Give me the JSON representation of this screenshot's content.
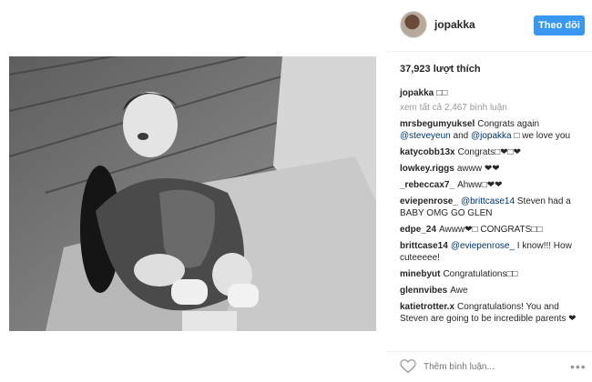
{
  "post": {
    "username": "jopakka",
    "follow_label": "Theo dõi",
    "likes": "37,923 lượt thích",
    "caption_user": "jopakka",
    "caption_text": "□□",
    "view_all": "xem tất cả 2,467 bình luận",
    "add_comment_placeholder": "Thêm bình luận...",
    "more_label": "•••"
  },
  "comments": [
    {
      "user": "mrsbegumyuksel",
      "pre": "Congrats again ",
      "mention1": "@steveyeun",
      "mid": " and ",
      "mention2": "@jopakka",
      "post": " □ we love you"
    },
    {
      "user": "katycobb13x",
      "text": "Congrats□❤□❤"
    },
    {
      "user": "lowkey.riggs",
      "text": "awww ❤❤"
    },
    {
      "user": "_rebeccax7_",
      "text": "Ahww□❤❤"
    },
    {
      "user": "eviepenrose_",
      "mention": "@brittcase14",
      "text": " Steven had a BABY OMG GO GLEN"
    },
    {
      "user": "edpe_24",
      "text": "Awww❤□ CONGRATS□□"
    },
    {
      "user": "brittcase14",
      "mention": "@eviepenrose_",
      "text": " I know!!! How cuteeeee!"
    },
    {
      "user": "minebyut",
      "text": "Congratulations□□"
    },
    {
      "user": "glennvibes",
      "text": "Awe"
    },
    {
      "user": "katietrotter.x",
      "text": "Congratulations! You and Steven are going to be incredible parents ❤"
    }
  ]
}
